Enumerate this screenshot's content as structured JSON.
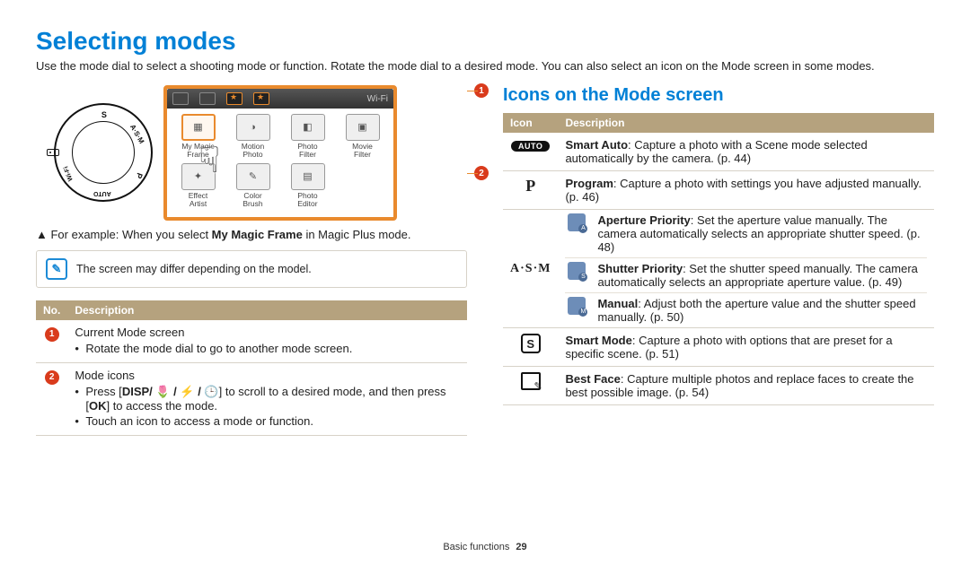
{
  "title": "Selecting modes",
  "intro": "Use the mode dial to select a shooting mode or function. Rotate the mode dial to a desired mode. You can also select an icon on the Mode screen in some modes.",
  "illustration": {
    "dial_labels": {
      "top": "S",
      "right": "A·S·M",
      "bottom_right": "P",
      "bottom": "AUTO",
      "bottom_left": "Wi-Fi"
    },
    "screen": {
      "wifi_label": "Wi-Fi",
      "items": [
        {
          "line1": "My Magic",
          "line2": "Frame",
          "selected": true
        },
        {
          "line1": "Motion",
          "line2": "Photo"
        },
        {
          "line1": "Photo",
          "line2": "Filter"
        },
        {
          "line1": "Movie",
          "line2": "Filter"
        },
        {
          "line1": "Effect",
          "line2": "Artist"
        },
        {
          "line1": "Color",
          "line2": "Brush"
        },
        {
          "line1": "Photo",
          "line2": "Editor"
        }
      ]
    },
    "callouts": {
      "one": "1",
      "two": "2"
    }
  },
  "example_prefix": "▲ For example: When you select ",
  "example_bold": "My Magic Frame",
  "example_suffix": " in Magic Plus mode.",
  "note": "The screen may differ depending on the model.",
  "left_table": {
    "headers": {
      "no": "No.",
      "desc": "Description"
    },
    "row1": {
      "num": "1",
      "title": "Current Mode screen",
      "bullet1": "Rotate the mode dial to go to another mode screen."
    },
    "row2": {
      "num": "2",
      "title": "Mode icons",
      "bullet1_a": "Press [",
      "bullet1_keys": "DISP/ 🌷 / ⚡ / 🕒",
      "bullet1_b": "] to scroll to a desired mode, and then press [",
      "bullet1_ok": "OK",
      "bullet1_c": "] to access the mode.",
      "bullet2": "Touch an icon to access a mode or function."
    }
  },
  "right_heading": "Icons on the Mode screen",
  "right_table": {
    "headers": {
      "icon": "Icon",
      "desc": "Description"
    },
    "rows": {
      "auto": {
        "label": "AUTO",
        "bold": "Smart Auto",
        "text": ": Capture a photo with a Scene mode selected automatically by the camera. (p. 44)"
      },
      "p": {
        "label": "P",
        "bold": "Program",
        "text": ": Capture a photo with settings you have adjusted manually. (p. 46)"
      },
      "asm": {
        "label": "A·S·M",
        "a": {
          "bold": "Aperture Priority",
          "text": ": Set the aperture value manually. The camera automatically selects an appropriate shutter speed. (p. 48)"
        },
        "s": {
          "bold": "Shutter Priority",
          "text": ": Set the shutter speed manually. The camera automatically selects an appropriate aperture value. (p. 49)"
        },
        "m": {
          "bold": "Manual",
          "text": ": Adjust both the aperture value and the shutter speed manually. (p. 50)"
        }
      },
      "smart": {
        "bold": "Smart Mode",
        "text": ": Capture a photo with options that are preset for a specific scene. (p. 51)"
      },
      "bestface": {
        "bold": "Best Face",
        "text": ": Capture multiple photos and replace faces to create the best possible image. (p. 54)"
      }
    }
  },
  "footer": {
    "section": "Basic functions",
    "page": "29"
  }
}
